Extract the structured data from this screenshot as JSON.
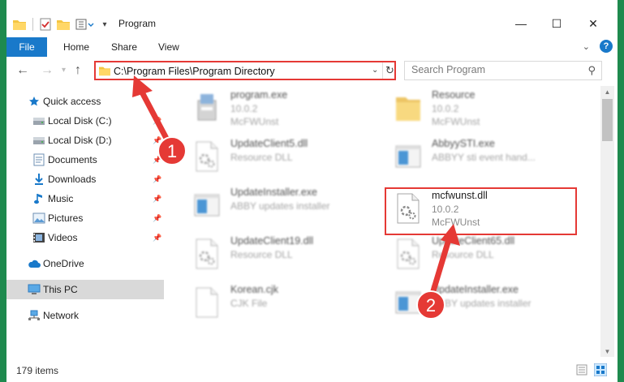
{
  "window": {
    "title": "Program",
    "minimize_glyph": "—",
    "maximize_glyph": "☐",
    "close_glyph": "✕"
  },
  "ribbon": {
    "tabs": [
      "File",
      "Home",
      "Share",
      "View"
    ],
    "help_glyph": "?",
    "collapse_glyph": "⌄"
  },
  "navbar": {
    "address": "C:\\Program Files\\Program Directory",
    "search_placeholder": "Search Program"
  },
  "sidebar": {
    "items": [
      {
        "label": "Quick access",
        "icon": "star-icon",
        "pinned": false
      },
      {
        "label": "Local Disk (C:)",
        "icon": "drive-icon",
        "pinned": true
      },
      {
        "label": "Local Disk (D:)",
        "icon": "drive-icon",
        "pinned": true
      },
      {
        "label": "Documents",
        "icon": "documents-icon",
        "pinned": true
      },
      {
        "label": "Downloads",
        "icon": "download-icon",
        "pinned": true
      },
      {
        "label": "Music",
        "icon": "music-icon",
        "pinned": true
      },
      {
        "label": "Pictures",
        "icon": "pictures-icon",
        "pinned": true
      },
      {
        "label": "Videos",
        "icon": "videos-icon",
        "pinned": true
      },
      {
        "label": "OneDrive",
        "icon": "cloud-icon",
        "pinned": false
      },
      {
        "label": "This PC",
        "icon": "computer-icon",
        "pinned": false
      },
      {
        "label": "Network",
        "icon": "network-icon",
        "pinned": false
      }
    ]
  },
  "files": [
    {
      "name": "program.exe",
      "line1": "10.0.2",
      "line2": "McFWUnst",
      "icon": "installer-icon"
    },
    {
      "name": "Resource",
      "line1": "10.0.2",
      "line2": "McFWUnst",
      "icon": "folder-zip-icon"
    },
    {
      "name": "UpdateClient5.dll",
      "line1": "Resource DLL",
      "line2": "",
      "icon": "dll-icon"
    },
    {
      "name": "AbbyySTI.exe",
      "line1": "ABBYY sti event hand...",
      "line2": "",
      "icon": "app-window-icon"
    },
    {
      "name": "UpdateInstaller.exe",
      "line1": "ABBY updates installer",
      "line2": "",
      "icon": "app-window-icon"
    },
    {
      "name": "mcfwunst.dll",
      "line1": "10.0.2",
      "line2": "McFWUnst",
      "icon": "dll-icon"
    },
    {
      "name": "UpdateClient19.dll",
      "line1": "Resource DLL",
      "line2": "",
      "icon": "dll-icon"
    },
    {
      "name": "UpdateClient65.dll",
      "line1": "Resource DLL",
      "line2": "",
      "icon": "dll-icon"
    },
    {
      "name": "Korean.cjk",
      "line1": "CJK File",
      "line2": "",
      "icon": "blank-file-icon"
    },
    {
      "name": "UpdateInstaller.exe",
      "line1": "ABBY updates installer",
      "line2": "",
      "icon": "app-window-icon"
    }
  ],
  "status": {
    "item_count": "179 items"
  },
  "annotations": {
    "step1": "1",
    "step2": "2",
    "color": "#e53935"
  }
}
